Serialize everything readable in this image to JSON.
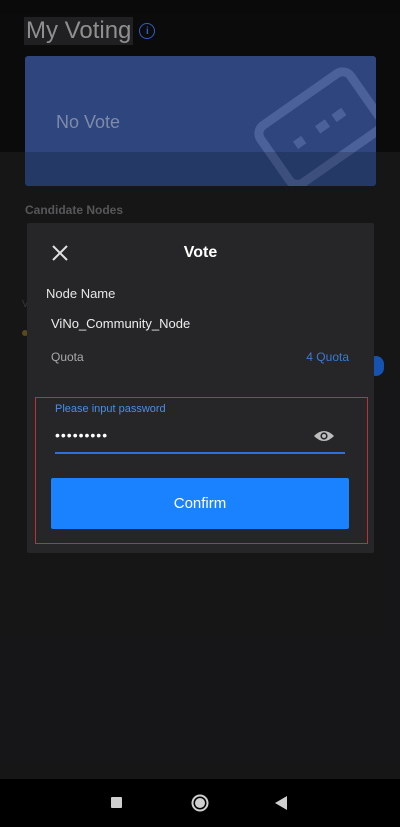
{
  "header": {
    "title": "My Voting",
    "info_glyph": "i"
  },
  "vote_card": {
    "status_text": "No Vote",
    "icon": "ticket-icon"
  },
  "candidate_section": {
    "label": "Candidate Nodes"
  },
  "modal": {
    "title": "Vote",
    "node_name_label": "Node Name",
    "node_name_value": "ViNo_Community_Node",
    "quota_label": "Quota",
    "quota_value": "4 Quota",
    "password": {
      "placeholder": "Please input password",
      "value": "•••••••••"
    },
    "confirm_label": "Confirm"
  },
  "colors": {
    "accent": "#1a82ff",
    "highlight_border": "#c0303a",
    "card_bg": "#2e467d",
    "modal_bg": "#262628"
  },
  "navigation": {
    "items": [
      "recents-icon",
      "home-icon",
      "back-icon"
    ]
  }
}
